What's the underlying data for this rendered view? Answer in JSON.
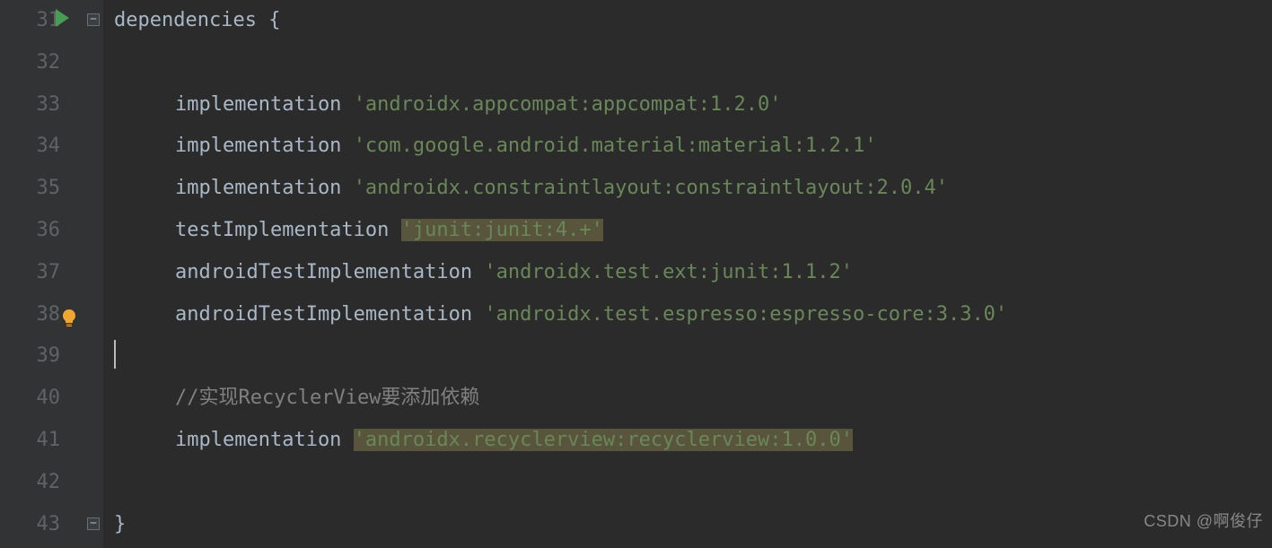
{
  "gutter": {
    "start": 31,
    "end": 43,
    "run_line": 31,
    "bulb_line": 38,
    "fold_open_line": 31,
    "fold_close_line": 43
  },
  "code": {
    "l31": {
      "keyword": "dependencies",
      "brace": "{"
    },
    "l33": {
      "method": "implementation",
      "string": "'androidx.appcompat:appcompat:1.2.0'"
    },
    "l34": {
      "method": "implementation",
      "string": "'com.google.android.material:material:1.2.1'"
    },
    "l35": {
      "method": "implementation",
      "string": "'androidx.constraintlayout:constraintlayout:2.0.4'"
    },
    "l36": {
      "method": "testImplementation",
      "string": "'junit:junit:4.+'"
    },
    "l37": {
      "method": "androidTestImplementation",
      "string": "'androidx.test.ext:junit:1.1.2'"
    },
    "l38": {
      "method": "androidTestImplementation",
      "string": "'androidx.test.espresso:espresso-core:3.3.0'"
    },
    "l40": {
      "comment": "//实现RecyclerView要添加依赖"
    },
    "l41": {
      "method": "implementation",
      "string": "'androidx.recyclerview:recyclerview:1.0.0'"
    },
    "l43": {
      "brace": "}"
    }
  },
  "highlights": {
    "l36": true,
    "l41": true
  },
  "caret_line": 39,
  "watermark": "CSDN @啊俊仔"
}
